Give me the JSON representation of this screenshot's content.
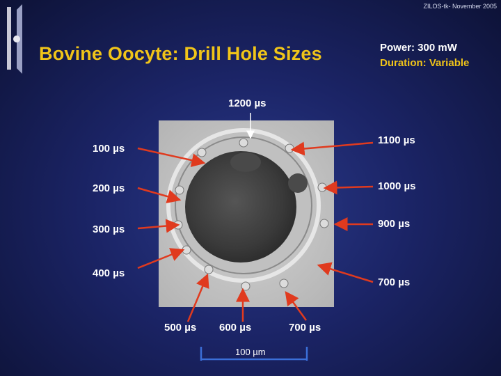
{
  "header": {
    "footer_note": "ZILOS-tk- November 2005",
    "title": "Bovine Oocyte: Drill Hole Sizes"
  },
  "params": {
    "power": "Power: 300 mW",
    "duration": "Duration: Variable"
  },
  "labels": {
    "l1200": "1200 µs",
    "l100": "100 µs",
    "l1100": "1100 µs",
    "l200": "200 µs",
    "l1000": "1000 µs",
    "l300": "300 µs",
    "l900": "900 µs",
    "l400": "400 µs",
    "l700r": "700 µs",
    "l500": "500 µs",
    "l600": "600 µs",
    "l700b": "700 µs"
  },
  "scale_bar": {
    "label": "100 µm"
  },
  "colors": {
    "title": "#f0c419",
    "arrow": "#e03a1e",
    "scale": "#3b6fd8"
  }
}
